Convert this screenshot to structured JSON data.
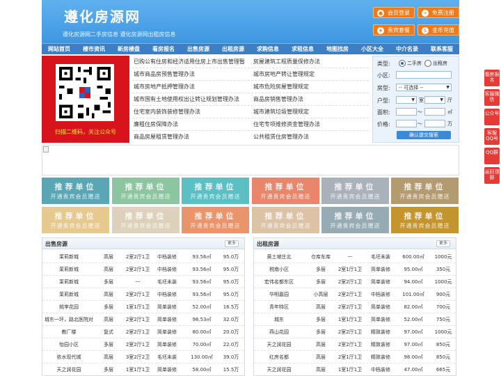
{
  "header": {
    "title": "遵化房源网",
    "subtitle": "遵化房源网二手房信息  遵化房源网出租房信息",
    "buttons": [
      "会员登录",
      "免费注册",
      "贵宾套餐",
      "金币充值"
    ]
  },
  "nav": [
    "网站首页",
    "楼市资讯",
    "新房楼盘",
    "看房报名",
    "出售房源",
    "出租房源",
    "求购信息",
    "求租信息",
    "地图找房",
    "小区大全",
    "中介名录",
    "联系客服"
  ],
  "qr": {
    "caption": "扫描二维码，关注公众号"
  },
  "links_left": [
    "已购公有住房和经济适用住房上市出售管理暂",
    "城市商品房预售管理办法",
    "城市房地产抵押管理办法",
    "城市国有土地使用权出让转让规划管理办法",
    "住宅室内装饰装修管理办法",
    "廉租住房保障办法",
    "商品房屋租赁管理办法"
  ],
  "links_right": [
    "房屋建筑工程质量保修办法",
    "城市房地产转让管理规定",
    "城市危险房屋管理规定",
    "商品房销售管理办法",
    "城市建筑垃圾管理规定",
    "住宅专项维修资金管理办法",
    "公共租赁住房管理办法"
  ],
  "search": {
    "type_label": "类型:",
    "type_options": [
      "二手房",
      "出租房"
    ],
    "community_label": "小区:",
    "housetype_label": "房型:",
    "housetype_placeholder": "-- 可选择 --",
    "layout_label": "户型:",
    "room_unit": "室",
    "hall_unit": "厅",
    "area_label": "面积:",
    "area_sep": "～",
    "area_unit": "㎡",
    "price_label": "价格:",
    "price_sep": "～",
    "price_unit": "万",
    "submit": "确认提交搜索"
  },
  "tiles": {
    "line1": "推荐单位",
    "line2": "开通贵宾会员赠送"
  },
  "tile_colors": [
    "#5aa6b5",
    "#8cc5a0",
    "#5bbfc4",
    "#e8866b",
    "#a9b2bb",
    "#b49a70",
    "#e6c98e",
    "#ded1bb",
    "#e9946a",
    "#dcc3a6",
    "#97abb5",
    "#c4952e"
  ],
  "sale": {
    "title": "出售房源",
    "more": "更多",
    "rows": [
      [
        "茉莉新城",
        "高层",
        "2室2厅1卫",
        "中档装修",
        "93.56㎡",
        "95.0万"
      ],
      [
        "茉莉新城",
        "高层",
        "2室2厅1卫",
        "中档装修",
        "93.56㎡",
        "95.0万"
      ],
      [
        "茉莉新城",
        "多层",
        "—",
        "毛坯未装",
        "93.56㎡",
        "95.0万"
      ],
      [
        "茉莉新城",
        "高层",
        "2室2厅1卫",
        "中档装修",
        "93.56㎡",
        "95.0万"
      ],
      [
        "桃李花园",
        "多层",
        "1室1厅1卫",
        "简单装修",
        "52.00㎡",
        "16.5万"
      ],
      [
        "城东一环，路北医院对",
        "高层",
        "2室2厅1卫",
        "简单装修",
        "98.53㎡",
        "32.0万"
      ],
      [
        "教厂楼",
        "复式",
        "2室2厅1卫",
        "简单装修",
        "80.00㎡",
        "20.0万"
      ],
      [
        "怡园小区",
        "多层",
        "2室2厅1卫",
        "简单装修",
        "70.00㎡",
        "22.0万"
      ],
      [
        "依水现代城",
        "高层",
        "3室2厅2卫",
        "毛坯未装",
        "130.00㎡",
        "39.0万"
      ],
      [
        "天之润花园",
        "多层",
        "1室1厅1卫",
        "简单装修",
        "58.00㎡",
        "15.5万"
      ]
    ]
  },
  "rent": {
    "title": "出租房源",
    "more": "更多",
    "rows": [
      [
        "黄土坡庄北",
        "仓库车库",
        "—",
        "毛坯未装",
        "600.00㎡",
        "1000元"
      ],
      [
        "税南小区",
        "多层",
        "2室1厅1卫",
        "简单装修",
        "95.00㎡",
        "350元"
      ],
      [
        "宏伟名都东区",
        "多层",
        "2室2厅1卫",
        "简单装修",
        "94.00㎡",
        "1000元"
      ],
      [
        "华明嘉园",
        "小高层",
        "2室2厅1卫",
        "中档装修",
        "101.00㎡",
        "900元"
      ],
      [
        "青年特区",
        "高层",
        "2室2厅1卫",
        "简单装修",
        "82.00㎡",
        "700元"
      ],
      [
        "城东",
        "多层",
        "1室1厅1卫",
        "简单装修",
        "52.00㎡",
        "750元"
      ],
      [
        "燕山花园",
        "多层",
        "2室2厅1卫",
        "精致装修",
        "97.00㎡",
        "1000元"
      ],
      [
        "天之润花园",
        "高层",
        "2室2厅1卫",
        "精致装修",
        "97.00㎡",
        "850元"
      ],
      [
        "红房名都",
        "高层",
        "2室1厅1卫",
        "精致装修",
        "98.00㎡",
        "850元"
      ],
      [
        "天之润花园",
        "高层",
        "1室1厅1卫",
        "中档装修",
        "47.00㎡",
        "665元"
      ]
    ]
  },
  "side": [
    "看房报名",
    "客服微信",
    "公众号",
    "客服QQ号",
    "QQ群",
    "返回顶部"
  ]
}
